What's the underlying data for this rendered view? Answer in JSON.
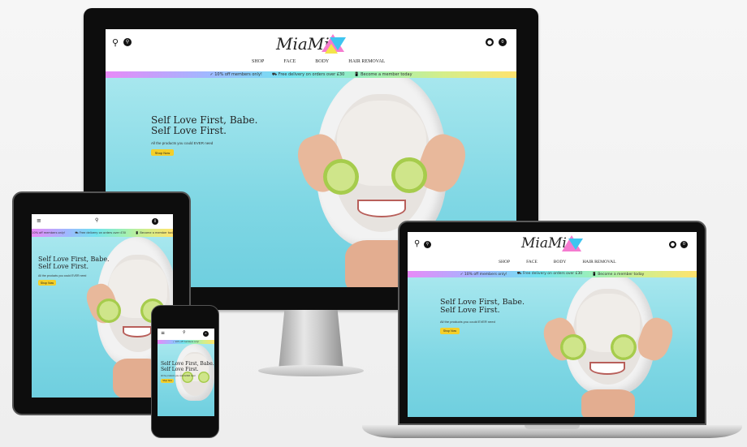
{
  "site": {
    "logo_text": "MiaMia",
    "nav": [
      "SHOP",
      "FACE",
      "BODY",
      "HAIR REMOVAL"
    ],
    "announcements": [
      "✓ 10% off members only!",
      "⛟ Free delivery on orders over £30",
      "📱 Become a member today"
    ],
    "hero_title_1": "Self Love First, Babe.",
    "hero_title_2": "Self Love First.",
    "hero_sub": "All the products you could EVER need",
    "cta": "Shop Now",
    "cart_count": "0"
  },
  "colors": {
    "accent": "#f4cf2a",
    "hero": "#7fd7e4",
    "device_frame": "#0d0d0d"
  },
  "icons": {
    "location": "map-pin-icon",
    "search": "search-icon",
    "account": "user-icon",
    "cart": "cart-icon",
    "menu": "hamburger-menu-icon"
  }
}
